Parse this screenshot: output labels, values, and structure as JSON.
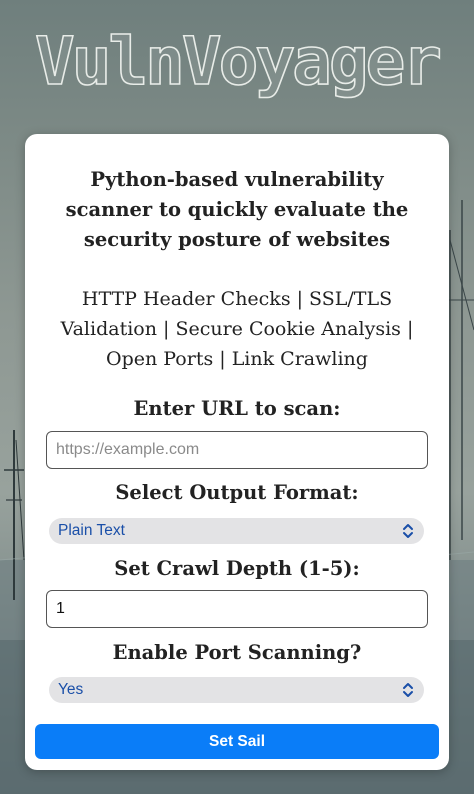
{
  "header": {
    "logo_text": "VulnVoyager"
  },
  "form": {
    "tagline": "Python-based vulnerability scanner to quickly evaluate the security posture of websites",
    "features": "HTTP Header Checks | SSL/TLS Validation | Secure Cookie Analysis | Open Ports | Link Crawling",
    "url": {
      "label": "Enter URL to scan:",
      "value": "",
      "placeholder": "https://example.com"
    },
    "output_format": {
      "label": "Select Output Format:",
      "selected": "Plain Text",
      "icon": "chevron-up-down-icon"
    },
    "crawl_depth": {
      "label": "Set Crawl Depth (1-5):",
      "value": "1"
    },
    "port_scanning": {
      "label": "Enable Port Scanning?",
      "selected": "Yes",
      "icon": "chevron-up-down-icon"
    },
    "submit_label": "Set Sail"
  },
  "colors": {
    "primary_button": "#0a7df8",
    "select_text": "#1a4fa8",
    "select_background": "#e3e3e5",
    "card_background": "#ffffff"
  }
}
